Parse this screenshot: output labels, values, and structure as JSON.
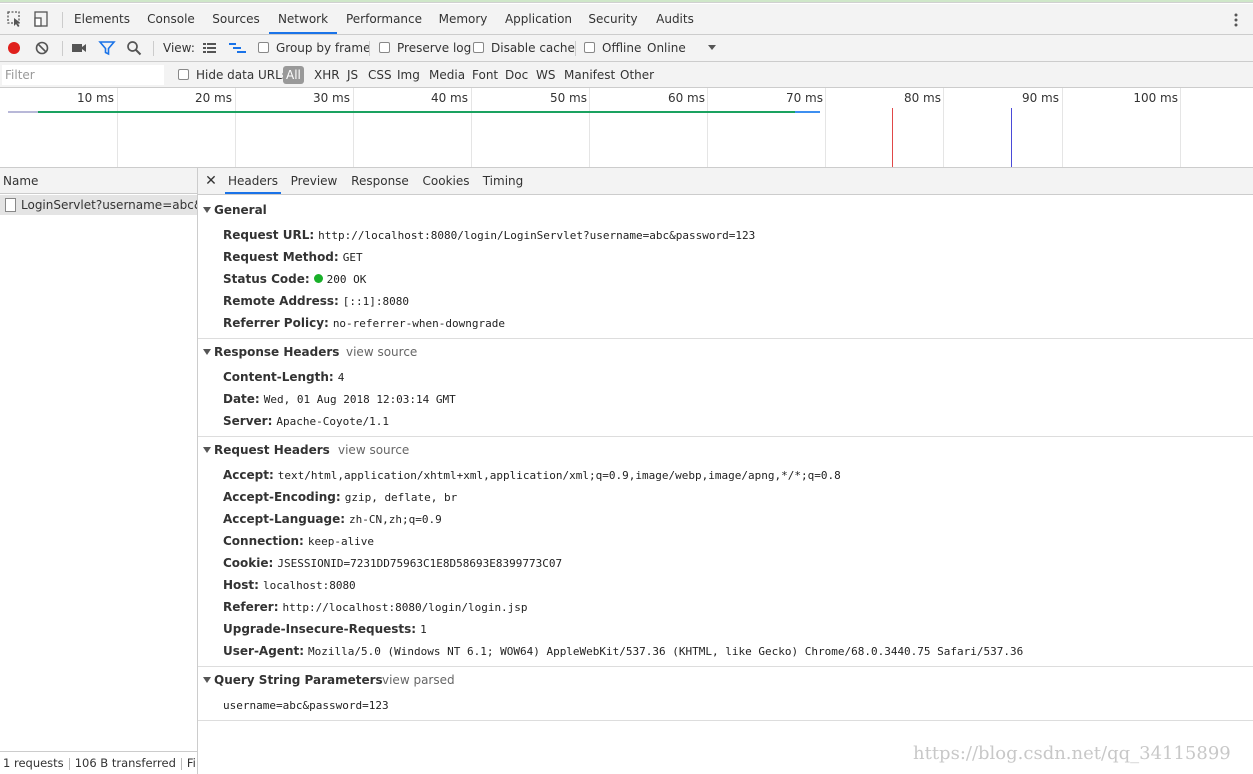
{
  "tabbar": {
    "tabs": [
      "Elements",
      "Console",
      "Sources",
      "Network",
      "Performance",
      "Memory",
      "Application",
      "Security",
      "Audits"
    ],
    "active_tab": "Network"
  },
  "toolbar": {
    "view_label": "View:",
    "group_by_frame": "Group by frame",
    "preserve_log": "Preserve log",
    "disable_cache": "Disable cache",
    "offline": "Offline",
    "throttle": "Online"
  },
  "filterbar": {
    "placeholder": "Filter",
    "hide_data_urls": "Hide data URLs",
    "types": [
      "All",
      "XHR",
      "JS",
      "CSS",
      "Img",
      "Media",
      "Font",
      "Doc",
      "WS",
      "Manifest",
      "Other"
    ]
  },
  "overview": {
    "ticks": [
      "10 ms",
      "20 ms",
      "30 ms",
      "40 ms",
      "50 ms",
      "60 ms",
      "70 ms",
      "80 ms",
      "90 ms",
      "100 ms"
    ],
    "colors": {
      "waiting": "#1aa260",
      "download": "#3d8ff0",
      "dom_loaded": "#4a4ad8",
      "load": "#e04848"
    }
  },
  "requests": {
    "header": "Name",
    "items": [
      {
        "name": "LoginServlet?username=abc&..."
      }
    ],
    "status": {
      "count": "1 requests",
      "transferred": "106 B transferred",
      "finish": "Fi..."
    }
  },
  "detail": {
    "tabs": [
      "Headers",
      "Preview",
      "Response",
      "Cookies",
      "Timing"
    ],
    "active_tab": "Headers",
    "general": {
      "title": "General",
      "rows": [
        {
          "key": "Request URL:",
          "value": "http://localhost:8080/login/LoginServlet?username=abc&password=123"
        },
        {
          "key": "Request Method:",
          "value": "GET"
        },
        {
          "key": "Status Code:",
          "value": "200 OK"
        },
        {
          "key": "Remote Address:",
          "value": "[::1]:8080"
        },
        {
          "key": "Referrer Policy:",
          "value": "no-referrer-when-downgrade"
        }
      ]
    },
    "response_headers": {
      "title": "Response Headers",
      "link": "view source",
      "rows": [
        {
          "key": "Content-Length:",
          "value": "4"
        },
        {
          "key": "Date:",
          "value": "Wed, 01 Aug 2018 12:03:14 GMT"
        },
        {
          "key": "Server:",
          "value": "Apache-Coyote/1.1"
        }
      ]
    },
    "request_headers": {
      "title": "Request Headers",
      "link": "view source",
      "rows": [
        {
          "key": "Accept:",
          "value": "text/html,application/xhtml+xml,application/xml;q=0.9,image/webp,image/apng,*/*;q=0.8"
        },
        {
          "key": "Accept-Encoding:",
          "value": "gzip, deflate, br"
        },
        {
          "key": "Accept-Language:",
          "value": "zh-CN,zh;q=0.9"
        },
        {
          "key": "Connection:",
          "value": "keep-alive"
        },
        {
          "key": "Cookie:",
          "value": "JSESSIONID=7231DD75963C1E8D58693E8399773C07"
        },
        {
          "key": "Host:",
          "value": "localhost:8080"
        },
        {
          "key": "Referer:",
          "value": "http://localhost:8080/login/login.jsp"
        },
        {
          "key": "Upgrade-Insecure-Requests:",
          "value": "1"
        },
        {
          "key": "User-Agent:",
          "value": "Mozilla/5.0 (Windows NT 6.1; WOW64) AppleWebKit/537.36 (KHTML, like Gecko) Chrome/68.0.3440.75 Safari/537.36"
        }
      ]
    },
    "query_string": {
      "title": "Query String Parameters",
      "link": "view parsed",
      "raw": "username=abc&password=123"
    }
  },
  "watermark": "https://blog.csdn.net/qq_34115899"
}
